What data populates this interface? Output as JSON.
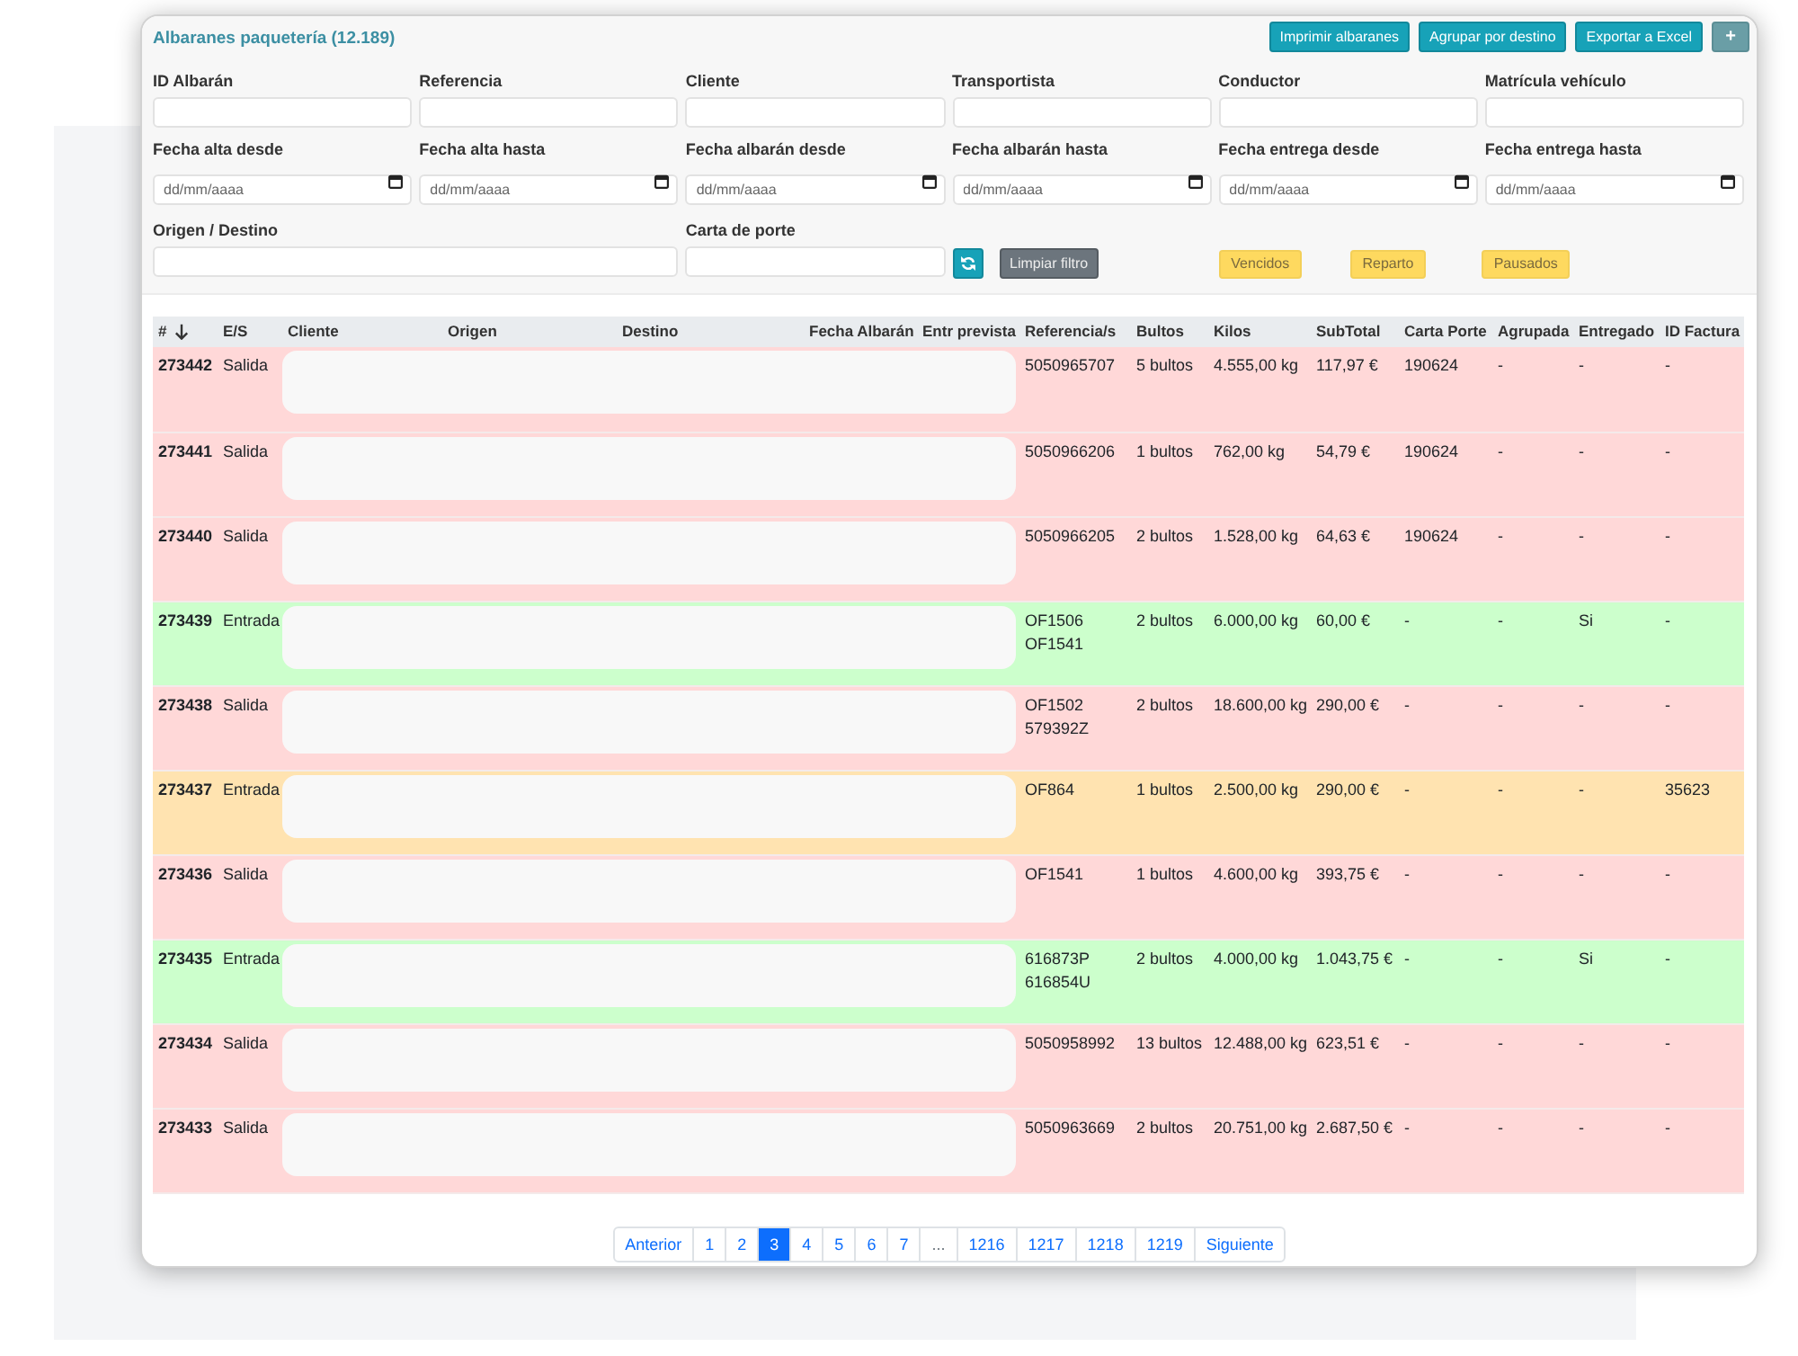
{
  "header": {
    "title": "Albaranes paquetería (12.189)",
    "actions": [
      {
        "label": "Imprimir albaranes",
        "kind": "text"
      },
      {
        "label": "Agrupar por destino",
        "kind": "text"
      },
      {
        "label": "Exportar a Excel",
        "kind": "text"
      },
      {
        "label": "+",
        "kind": "symbol"
      }
    ]
  },
  "filters": [
    {
      "label": "ID Albarán",
      "kind": "text"
    },
    {
      "label": "Referencia",
      "kind": "text"
    },
    {
      "label": "Cliente",
      "kind": "text"
    },
    {
      "label": "Transportista",
      "kind": "text"
    },
    {
      "label": "Conductor",
      "kind": "text"
    },
    {
      "label": "Matrícula vehículo",
      "kind": "text"
    },
    {
      "label": "Fecha alta desde",
      "kind": "date",
      "placeholder": "dd/mm/aaaa"
    },
    {
      "label": "Fecha alta hasta",
      "kind": "date",
      "placeholder": "dd/mm/aaaa"
    },
    {
      "label": "Fecha albarán desde",
      "kind": "date",
      "placeholder": "dd/mm/aaaa"
    },
    {
      "label": "Fecha albarán hasta",
      "kind": "date",
      "placeholder": "dd/mm/aaaa"
    },
    {
      "label": "Fecha entrega desde",
      "kind": "date",
      "placeholder": "dd/mm/aaaa"
    },
    {
      "label": "Fecha entrega hasta",
      "kind": "date",
      "placeholder": "dd/mm/aaaa"
    },
    {
      "label": "Origen / Destino",
      "kind": "long_text"
    },
    {
      "label": "Carta de porte",
      "kind": "text"
    }
  ],
  "filter_actions": {
    "clear_label": "Limpiar filtro"
  },
  "quick_filters": [
    {
      "label": "Vencidos",
      "selected": false
    },
    {
      "label": "Reparto",
      "selected": false
    },
    {
      "label": "Pausados",
      "selected": false
    }
  ],
  "table": {
    "columns": [
      {
        "label": "#",
        "sorted_descending": true
      },
      {
        "label": "E/S"
      },
      {
        "label": "Cliente"
      },
      {
        "label": "Origen"
      },
      {
        "label": "Destino"
      },
      {
        "label": "Fecha Albarán"
      },
      {
        "label": "Entr prevista"
      },
      {
        "label": "Referencia/s"
      },
      {
        "label": "Bultos"
      },
      {
        "label": "Kilos"
      },
      {
        "label": "SubTotal"
      },
      {
        "label": "Carta Porte"
      },
      {
        "label": "Agrupada"
      },
      {
        "label": "Entregado"
      },
      {
        "label": "ID Factura"
      }
    ],
    "rows": [
      {
        "id": "273442",
        "direction": "Salida",
        "redacted": true,
        "references": [
          "5050965707"
        ],
        "packages": "5 bultos",
        "weight": "4.555,00 kg",
        "subtotal": "117,97 €",
        "waybill": "190624",
        "grouped": "-",
        "delivered": "-",
        "invoice": "-",
        "color": "#ffd8d8"
      },
      {
        "id": "273441",
        "direction": "Salida",
        "redacted": true,
        "references": [
          "5050966206"
        ],
        "packages": "1 bultos",
        "weight": "762,00 kg",
        "subtotal": "54,79 €",
        "waybill": "190624",
        "grouped": "-",
        "delivered": "-",
        "invoice": "-",
        "color": "#ffd8d8"
      },
      {
        "id": "273440",
        "direction": "Salida",
        "redacted": true,
        "references": [
          "5050966205"
        ],
        "packages": "2 bultos",
        "weight": "1.528,00 kg",
        "subtotal": "64,63 €",
        "waybill": "190624",
        "grouped": "-",
        "delivered": "-",
        "invoice": "-",
        "color": "#ffd8d8"
      },
      {
        "id": "273439",
        "direction": "Entrada",
        "redacted": true,
        "references": [
          "OF1506",
          "OF1541"
        ],
        "packages": "2 bultos",
        "weight": "6.000,00 kg",
        "subtotal": "60,00 €",
        "waybill": "-",
        "grouped": "-",
        "delivered": "Si",
        "invoice": "-",
        "color": "#ccffcc"
      },
      {
        "id": "273438",
        "direction": "Salida",
        "redacted": true,
        "references": [
          "OF1502",
          "579392Z"
        ],
        "packages": "2 bultos",
        "weight": "18.600,00 kg",
        "subtotal": "290,00 €",
        "waybill": "-",
        "grouped": "-",
        "delivered": "-",
        "invoice": "-",
        "color": "#ffd8d8"
      },
      {
        "id": "273437",
        "direction": "Entrada",
        "redacted": true,
        "references": [
          "OF864"
        ],
        "packages": "1 bultos",
        "weight": "2.500,00 kg",
        "subtotal": "290,00 €",
        "waybill": "-",
        "grouped": "-",
        "delivered": "-",
        "invoice": "35623",
        "color": "#ffe3b0"
      },
      {
        "id": "273436",
        "direction": "Salida",
        "redacted": true,
        "references": [
          "OF1541"
        ],
        "packages": "1 bultos",
        "weight": "4.600,00 kg",
        "subtotal": "393,75 €",
        "waybill": "-",
        "grouped": "-",
        "delivered": "-",
        "invoice": "-",
        "color": "#ffd8d8"
      },
      {
        "id": "273435",
        "direction": "Entrada",
        "redacted": true,
        "references": [
          "616873P",
          "616854U"
        ],
        "packages": "2 bultos",
        "weight": "4.000,00 kg",
        "subtotal": "1.043,75 €",
        "waybill": "-",
        "grouped": "-",
        "delivered": "Si",
        "invoice": "-",
        "color": "#ccffcc"
      },
      {
        "id": "273434",
        "direction": "Salida",
        "redacted": true,
        "references": [
          "5050958992"
        ],
        "packages": "13 bultos",
        "weight": "12.488,00 kg",
        "subtotal": "623,51 €",
        "waybill": "-",
        "grouped": "-",
        "delivered": "-",
        "invoice": "-",
        "color": "#ffd8d8"
      },
      {
        "id": "273433",
        "direction": "Salida",
        "redacted": true,
        "references": [
          "5050963669"
        ],
        "packages": "2 bultos",
        "weight": "20.751,00 kg",
        "subtotal": "2.687,50 €",
        "waybill": "-",
        "grouped": "-",
        "delivered": "-",
        "invoice": "-",
        "color": "#ffd8d8"
      }
    ]
  },
  "pagination": {
    "previous": "Anterior",
    "next": "Siguiente",
    "pages": [
      {
        "label": "1",
        "kind": "page",
        "selected": false
      },
      {
        "label": "2",
        "kind": "page",
        "selected": false
      },
      {
        "label": "3",
        "kind": "page",
        "selected": true
      },
      {
        "label": "4",
        "kind": "page",
        "selected": false
      },
      {
        "label": "5",
        "kind": "page",
        "selected": false
      },
      {
        "label": "6",
        "kind": "page",
        "selected": false
      },
      {
        "label": "7",
        "kind": "page",
        "selected": false
      },
      {
        "label": "...",
        "kind": "ellipsis"
      },
      {
        "label": "1216",
        "kind": "page",
        "selected": false
      },
      {
        "label": "1217",
        "kind": "page",
        "selected": false
      },
      {
        "label": "1218",
        "kind": "page",
        "selected": false
      },
      {
        "label": "1219",
        "kind": "page",
        "selected": false
      }
    ]
  }
}
